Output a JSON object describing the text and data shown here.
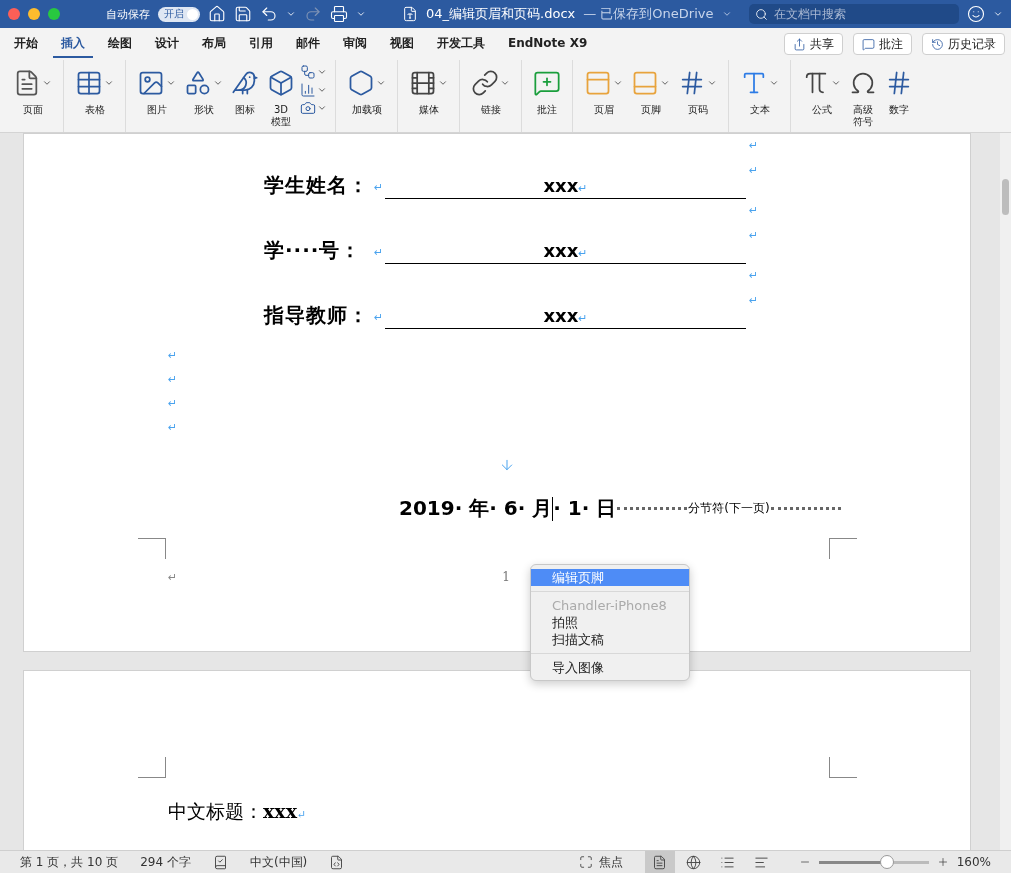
{
  "title_bar": {
    "autosave_label": "自动保存",
    "autosave_toggle": {
      "label": "开启",
      "on": true
    },
    "document_title": "04_编辑页眉和页码.docx",
    "save_status": " — 已保存到OneDrive",
    "search": {
      "placeholder": "在文档中搜索"
    }
  },
  "tabs": [
    {
      "label": "开始",
      "selected": false
    },
    {
      "label": "插入",
      "selected": true
    },
    {
      "label": "绘图",
      "selected": false
    },
    {
      "label": "设计",
      "selected": false
    },
    {
      "label": "布局",
      "selected": false
    },
    {
      "label": "引用",
      "selected": false
    },
    {
      "label": "邮件",
      "selected": false
    },
    {
      "label": "审阅",
      "selected": false
    },
    {
      "label": "视图",
      "selected": false
    },
    {
      "label": "开发工具",
      "selected": false
    },
    {
      "label": "EndNote X9",
      "selected": false
    }
  ],
  "tab_actions": [
    "共享",
    "批注",
    "历史记录"
  ],
  "ribbon": [
    [
      {
        "kind": "large",
        "label": "页面",
        "caret": true
      }
    ],
    [
      {
        "kind": "large",
        "label": "表格",
        "caret": true
      }
    ],
    [
      {
        "kind": "large",
        "label": "图片",
        "caret": true
      },
      {
        "kind": "large",
        "label": "形状",
        "caret": true
      },
      {
        "kind": "large",
        "label": "图标",
        "caret": false
      },
      {
        "kind": "large",
        "label": "3D",
        "label_2": "模型",
        "caret": false
      },
      {
        "kind": "stack",
        "items": [
          {
            "caret": true
          },
          {
            "caret": true
          },
          {
            "caret": true
          }
        ]
      }
    ],
    [
      {
        "kind": "large",
        "label": "加载项",
        "caret": true
      }
    ],
    [
      {
        "kind": "large",
        "label": "媒体",
        "caret": true
      }
    ],
    [
      {
        "kind": "large",
        "label": "链接",
        "caret": true
      }
    ],
    [
      {
        "kind": "large",
        "label": "批注",
        "caret": false
      }
    ],
    [
      {
        "kind": "large",
        "label": "页眉",
        "caret": true
      },
      {
        "kind": "large",
        "label": "页脚",
        "caret": true
      },
      {
        "kind": "large",
        "label": "页码",
        "caret": true
      }
    ],
    [
      {
        "kind": "large",
        "label": "文本",
        "caret": true
      }
    ],
    [
      {
        "kind": "large",
        "label": "公式",
        "caret": true
      },
      {
        "kind": "large",
        "label": "高级",
        "label_2": "符号",
        "caret": false
      },
      {
        "kind": "large",
        "label": "数字",
        "caret": false
      }
    ]
  ],
  "page_1": {
    "form_rows": [
      {
        "label": "学生姓名：",
        "label_mark": "↵",
        "value": "xxx",
        "value_mark": "↵",
        "end_marks": [
          "↵",
          "↵"
        ]
      },
      {
        "label": "学····号：",
        "label_mark": "↵",
        "value": "xxx",
        "value_mark": "↵",
        "end_marks": [
          "↵",
          "↵"
        ]
      },
      {
        "label": "指导教师：",
        "label_mark": "↵",
        "value": "xxx",
        "value_mark": "↵",
        "end_marks": [
          "↵",
          "↵"
        ]
      }
    ],
    "empty_paragraphs": [
      "↵",
      "↵",
      "↵",
      "↵"
    ],
    "date_before_cursor": "2019· 年· 6· 月",
    "date_after_cursor": "· 1· 日",
    "section_break": "分节符(下一页)",
    "footer": {
      "mark": "↵",
      "page_number": "1"
    }
  },
  "context_menu": [
    {
      "kind": "item",
      "label": "编辑页脚",
      "selected": true,
      "disabled": false
    },
    {
      "kind": "separator"
    },
    {
      "kind": "item",
      "label": "Chandler-iPhone8",
      "selected": false,
      "disabled": true
    },
    {
      "kind": "item",
      "label": "拍照",
      "selected": false,
      "disabled": false
    },
    {
      "kind": "item",
      "label": "扫描文稿",
      "selected": false,
      "disabled": false
    },
    {
      "kind": "separator"
    },
    {
      "kind": "item",
      "label": "导入图像",
      "selected": false,
      "disabled": false
    }
  ],
  "page_2": {
    "heading_label": "中文标题：",
    "heading_value": "xxx",
    "heading_mark": "↵"
  },
  "status_bar": {
    "page_info": "第 1 页，共 10 页",
    "word_count": "294 个字",
    "language": "中文(中国)",
    "focus": "焦点",
    "views": [
      {
        "selected": true
      },
      {
        "selected": false
      },
      {
        "selected": false
      },
      {
        "selected": false
      }
    ],
    "zoom": {
      "level": 0.62
    },
    "zoom_label": "160%"
  }
}
